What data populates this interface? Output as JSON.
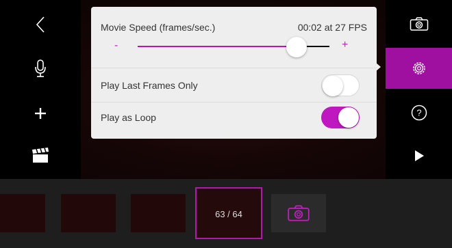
{
  "settings": {
    "movie_speed_label": "Movie Speed (frames/sec.)",
    "speed_readout": "00:02 at 27 FPS",
    "speed_slider": {
      "min_label": "-",
      "max_label": "+",
      "value_fraction": 0.83
    },
    "play_last_frames_label": "Play Last Frames Only",
    "play_last_frames_on": false,
    "play_as_loop_label": "Play as Loop",
    "play_as_loop_on": true
  },
  "left_toolbar": {
    "icons": [
      "back-chevron-icon",
      "microphone-icon",
      "plus-icon",
      "clapperboard-icon"
    ]
  },
  "right_toolbar": {
    "icons": [
      "camera-icon",
      "settings-gear-icon",
      "help-icon",
      "play-icon"
    ],
    "active": "settings-gear-icon"
  },
  "filmstrip": {
    "frame_counter": "63 / 64"
  },
  "colors": {
    "accent": "#b018b0",
    "panel": "#eeeeee",
    "filmstrip": "#1e1e1e"
  }
}
